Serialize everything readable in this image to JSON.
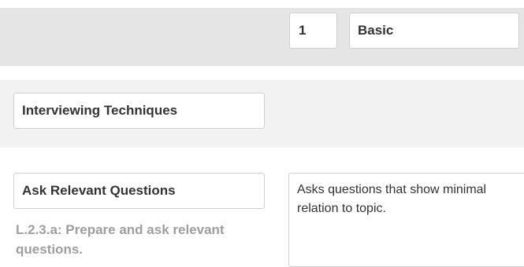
{
  "level": {
    "number": "1",
    "name": "Basic"
  },
  "skill": {
    "category": "Interviewing Techniques",
    "name": "Ask Relevant Questions",
    "standard": "L.2.3.a: Prepare and ask relevant questions.",
    "descriptor": "Asks questions that show minimal relation to topic."
  }
}
